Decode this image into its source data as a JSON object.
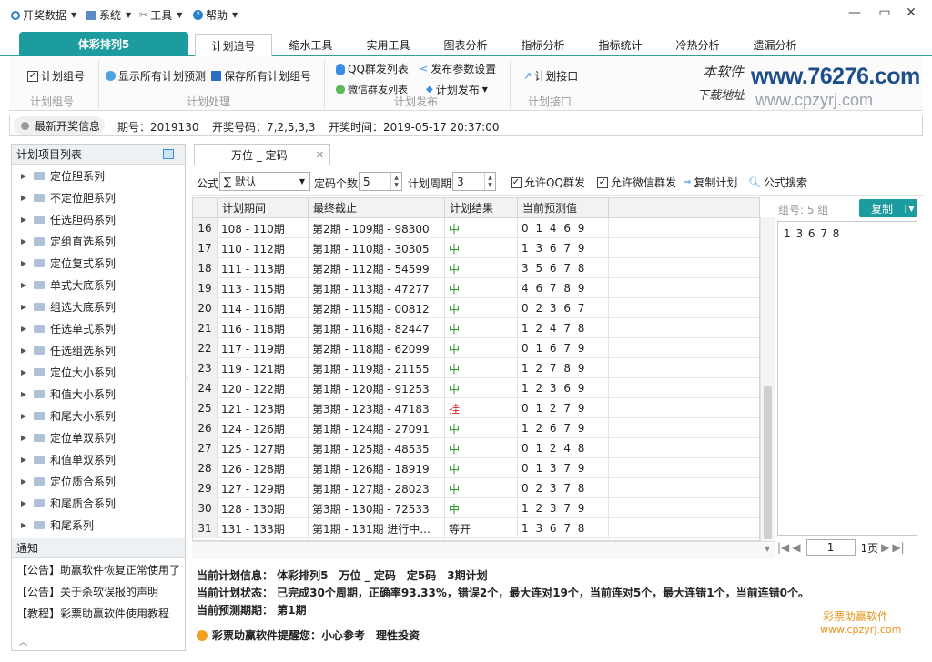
{
  "menu": {
    "items": [
      {
        "label": "开奖数据",
        "icon": "circle-icon"
      },
      {
        "label": "系统",
        "icon": "grid-icon"
      },
      {
        "label": "工具",
        "icon": "tools-icon"
      },
      {
        "label": "帮助",
        "icon": "help-icon"
      }
    ]
  },
  "app_tab": "体彩排列5",
  "tabs": [
    "计划追号",
    "缩水工具",
    "实用工具",
    "图表分析",
    "指标分析",
    "指标统计",
    "冷热分析",
    "遗漏分析"
  ],
  "ribbon": {
    "plan_group": {
      "btn": "计划组号",
      "section": "计划组号"
    },
    "plan_process": {
      "show_all": "显示所有计划预测",
      "save_all": "保存所有计划组号",
      "section": "计划处理"
    },
    "plan_publish": {
      "qq_list": "QQ群发列表",
      "publish_params": "发布参数设置",
      "wechat_list": "微信群发列表",
      "publish": "计划发布",
      "section": "计划发布"
    },
    "plan_api": {
      "btn": "计划接口",
      "section": "计划接口"
    },
    "watermark_cn1": "本软件",
    "watermark_cn2": "下载地址",
    "watermark_url1": "www.76276.com",
    "watermark_url2": "www.cpzyrj.com"
  },
  "status": {
    "title": "最新开奖信息",
    "issue_label": "期号：",
    "issue": "2019130",
    "numbers_label": "开奖号码：",
    "numbers": "7,2,5,3,3",
    "time_label": "开奖时间：",
    "time": "2019-05-17 20:37:00"
  },
  "left": {
    "title": "计划项目列表",
    "items": [
      "定位胆系列",
      "不定位胆系列",
      "任选胆码系列",
      "定组直选系列",
      "定位复式系列",
      "单式大底系列",
      "组选大底系列",
      "任选单式系列",
      "任选组选系列",
      "定位大小系列",
      "和值大小系列",
      "和尾大小系列",
      "定位单双系列",
      "和值单双系列",
      "定位质合系列",
      "和尾质合系列",
      "和尾系列"
    ],
    "notice_title": "通知",
    "notices": [
      "【公告】助赢软件恢复正常使用了",
      "【公告】关于杀软误报的声明",
      "【教程】彩票助赢软件使用教程"
    ]
  },
  "doc_tab": "万位 _ 定码",
  "toolbar": {
    "formula_label": "公式",
    "formula_value": "∑ 默认",
    "count_label": "定码个数",
    "count_value": "5",
    "period_label": "计划周期",
    "period_value": "3",
    "allow_qq": "允许QQ群发",
    "allow_wechat": "允许微信群发",
    "copy_plan": "复制计划",
    "formula_search": "公式搜索"
  },
  "table": {
    "headers": [
      "计划期间",
      "最终截止",
      "计划结果",
      "当前预测值"
    ],
    "rows": [
      [
        "16",
        "108 - 110期",
        "第2期 - 109期 - 98300",
        "中",
        "0 1 4 6 9"
      ],
      [
        "17",
        "110 - 112期",
        "第1期 - 110期 - 30305",
        "中",
        "1 3 6 7 9"
      ],
      [
        "18",
        "111 - 113期",
        "第2期 - 112期 - 54599",
        "中",
        "3 5 6 7 8"
      ],
      [
        "19",
        "113 - 115期",
        "第1期 - 113期 - 47277",
        "中",
        "4 6 7 8 9"
      ],
      [
        "20",
        "114 - 116期",
        "第2期 - 115期 - 00812",
        "中",
        "0 2 3 6 7"
      ],
      [
        "21",
        "116 - 118期",
        "第1期 - 116期 - 82447",
        "中",
        "1 2 4 7 8"
      ],
      [
        "22",
        "117 - 119期",
        "第2期 - 118期 - 62099",
        "中",
        "0 1 6 7 9"
      ],
      [
        "23",
        "119 - 121期",
        "第1期 - 119期 - 21155",
        "中",
        "1 2 7 8 9"
      ],
      [
        "24",
        "120 - 122期",
        "第1期 - 120期 - 91253",
        "中",
        "1 2 3 6 9"
      ],
      [
        "25",
        "121 - 123期",
        "第3期 - 123期 - 47183",
        "挂",
        "0 1 2 7 9"
      ],
      [
        "26",
        "124 - 126期",
        "第1期 - 124期 - 27091",
        "中",
        "1 2 6 7 9"
      ],
      [
        "27",
        "125 - 127期",
        "第1期 - 125期 - 48535",
        "中",
        "0 1 2 4 8"
      ],
      [
        "28",
        "126 - 128期",
        "第1期 - 126期 - 18919",
        "中",
        "0 1 3 7 9"
      ],
      [
        "29",
        "127 - 129期",
        "第1期 - 127期 - 28023",
        "中",
        "0 2 3 7 8"
      ],
      [
        "30",
        "128 - 130期",
        "第3期 - 130期 - 72533",
        "中",
        "1 2 3 7 9"
      ],
      [
        "31",
        "131 - 133期",
        "第1期 - 131期 进行中...",
        "等开",
        "1 3 6 7 8"
      ]
    ]
  },
  "right": {
    "group_label": "组号: 5 组",
    "copy_btn": "复制",
    "result_text": "1 3 6 7 8",
    "page_value": "1",
    "page_total": "1页"
  },
  "info": {
    "line1": "当前计划信息： 体彩排列5　万位 _ 定码　定5码　3期计划",
    "line2": "当前计划状态： 已完成30个周期，正确率93.33%，错误2个，最大连对19个，当前连对5个，最大连错1个，当前连错0个。",
    "line3": "当前预测期期： 第1期",
    "line4": "彩票助赢软件提醒您：小心参考　理性投资",
    "brand": "彩票助赢软件",
    "brand_url": "www.cpzyrj.com"
  },
  "colors": {
    "accent": "#1d9ca0",
    "win": "#1a8f1a",
    "lose": "#e02020"
  }
}
